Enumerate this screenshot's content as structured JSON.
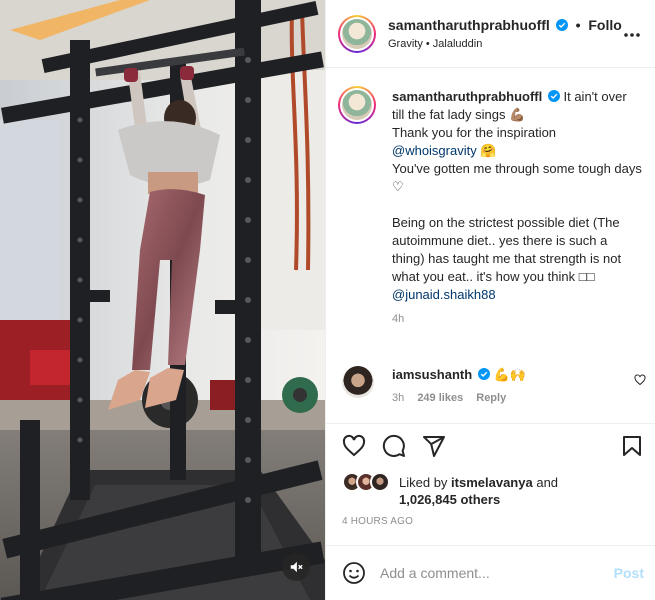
{
  "post": {
    "username": "samantharuthprabhuoffl",
    "follow_label": "Follo",
    "separator": "•",
    "audio": "Gravity • Jalaluddin"
  },
  "caption": {
    "username": "samantharuthprabhuoffl",
    "line1": "It ain't over till the fat lady sings",
    "line1_emoji": "💪🏽",
    "line2": "Thank you for the inspiration",
    "mention1": "@whoisgravity",
    "mention1_emoji": "🤗",
    "line3": "You've gotten me through some tough days",
    "line3_emoji": "♡",
    "para2": "Being on the strictest possible diet (The autoimmune diet.. yes there is such a thing) has taught me that strength is not what you eat.. it's how you think",
    "para2_emoji": "□□",
    "mention2": "@junaid.shaikh88",
    "age": "4h"
  },
  "comment": {
    "username": "iamsushanth",
    "text": "💪🙌",
    "age": "3h",
    "likes": "249 likes",
    "reply": "Reply"
  },
  "likes": {
    "prefix": "Liked by",
    "user": "itsmelavanya",
    "and": "and",
    "others": "1,026,845 others"
  },
  "timestamp": "4 HOURS AGO",
  "add_comment": {
    "placeholder": "Add a comment...",
    "post_label": "Post"
  },
  "icons": {
    "header": [
      "verified-icon",
      "more-icon"
    ],
    "actions": [
      "heart-icon",
      "comment-icon",
      "share-icon",
      "bookmark-icon"
    ],
    "media": [
      "mute-icon"
    ],
    "composer": [
      "emoji-icon"
    ]
  },
  "colors": {
    "text": "#262626",
    "secondary": "#8e8e8e",
    "mention": "#00376b",
    "verified": "#0095f6",
    "post_disabled": "#b2dffc",
    "divider": "#efefef"
  }
}
